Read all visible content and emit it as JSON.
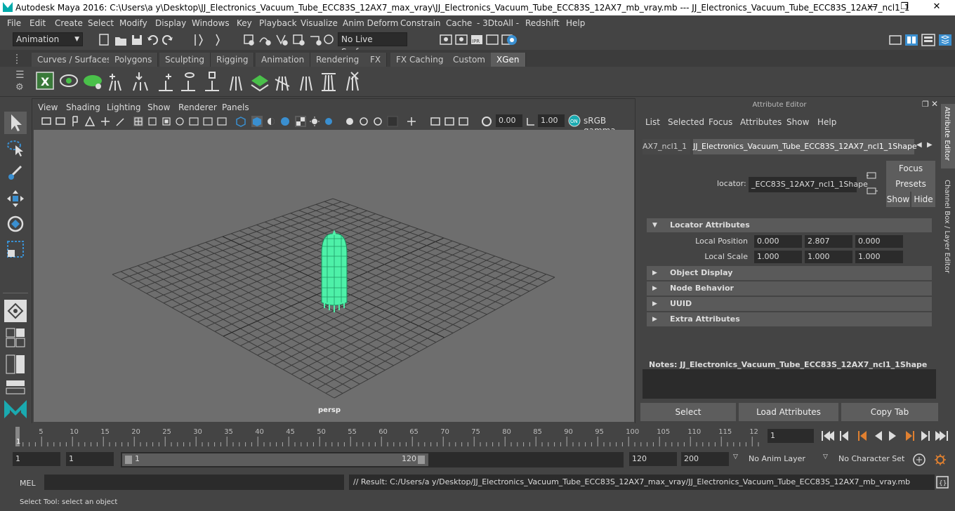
{
  "window": {
    "title": "Autodesk Maya 2016: C:\\Users\\a y\\Desktop\\JJ_Electronics_Vacuum_Tube_ECC83S_12AX7_max_vray\\JJ_Electronics_Vacuum_Tube_ECC83S_12AX7_mb_vray.mb   ---   JJ_Electronics_Vacuum_Tube_ECC83S_12AX7_ncl1_1",
    "minimize": "—",
    "restore": "❐",
    "close": "✕"
  },
  "menubar": [
    "File",
    "Edit",
    "Create",
    "Select",
    "Modify",
    "Display",
    "Windows",
    "Key",
    "Playback",
    "Visualize",
    "Anim Deform",
    "Constrain",
    "Cache",
    "- 3DtoAll -",
    "Redshift",
    "Help"
  ],
  "statusline": {
    "mode": "Animation",
    "live_surface": "No Live Surface"
  },
  "shelf_tabs": [
    "Curves / Surfaces",
    "Polygons",
    "Sculpting",
    "Rigging",
    "Animation",
    "Rendering",
    "FX",
    "FX Caching",
    "Custom",
    "XGen"
  ],
  "shelf_active": "XGen",
  "viewport": {
    "menu": [
      "View",
      "Shading",
      "Lighting",
      "Show",
      "Renderer",
      "Panels"
    ],
    "exposure": "0.00",
    "gamma": "1.00",
    "colorspace": "sRGB gamma",
    "camera": "persp"
  },
  "attribute_editor": {
    "header": "Attribute Editor",
    "menu": [
      "List",
      "Selected",
      "Focus",
      "Attributes",
      "Show",
      "Help"
    ],
    "tab_prev": "AX7_ncl1_1",
    "tab_active": "JJ_Electronics_Vacuum_Tube_ECC83S_12AX7_ncl1_1Shape",
    "locator_label": "locator:",
    "locator_value": "_ECC83S_12AX7_ncl1_1Shape",
    "buttons": {
      "focus": "Focus",
      "presets": "Presets",
      "show": "Show",
      "hide": "Hide"
    },
    "section_locator": "Locator Attributes",
    "local_position_label": "Local Position",
    "local_position": [
      "0.000",
      "2.807",
      "0.000"
    ],
    "local_scale_label": "Local Scale",
    "local_scale": [
      "1.000",
      "1.000",
      "1.000"
    ],
    "sections": [
      "Object Display",
      "Node Behavior",
      "UUID",
      "Extra Attributes"
    ],
    "notes": "Notes:  JJ_Electronics_Vacuum_Tube_ECC83S_12AX7_ncl1_1Shape",
    "bottom_buttons": [
      "Select",
      "Load Attributes",
      "Copy Tab"
    ]
  },
  "side_tabs": [
    "Attribute Editor",
    "Channel Box / Layer Editor"
  ],
  "timeline": {
    "ticks": [
      "5",
      "10",
      "15",
      "20",
      "25",
      "30",
      "35",
      "40",
      "45",
      "50",
      "55",
      "60",
      "65",
      "70",
      "75",
      "80",
      "85",
      "90",
      "95",
      "100",
      "105",
      "110",
      "115",
      "12"
    ],
    "start_marker": "1",
    "current_frame": "1"
  },
  "range": {
    "start": "1",
    "playback_start": "1",
    "slider_start": "1",
    "slider_end": "120",
    "playback_end": "120",
    "end": "200",
    "anim_layer": "No Anim Layer",
    "character_set": "No Character Set"
  },
  "command": {
    "label": "MEL",
    "result": "// Result: C:/Users/a y/Desktop/JJ_Electronics_Vacuum_Tube_ECC83S_12AX7_max_vray/JJ_Electronics_Vacuum_Tube_ECC83S_12AX7_mb_vray.mb"
  },
  "helpline": "Select Tool: select an object",
  "colors": {
    "accent": "#3a8fd0",
    "model": "#4ef0a8",
    "xgen_tab": "#5d5d5d"
  }
}
